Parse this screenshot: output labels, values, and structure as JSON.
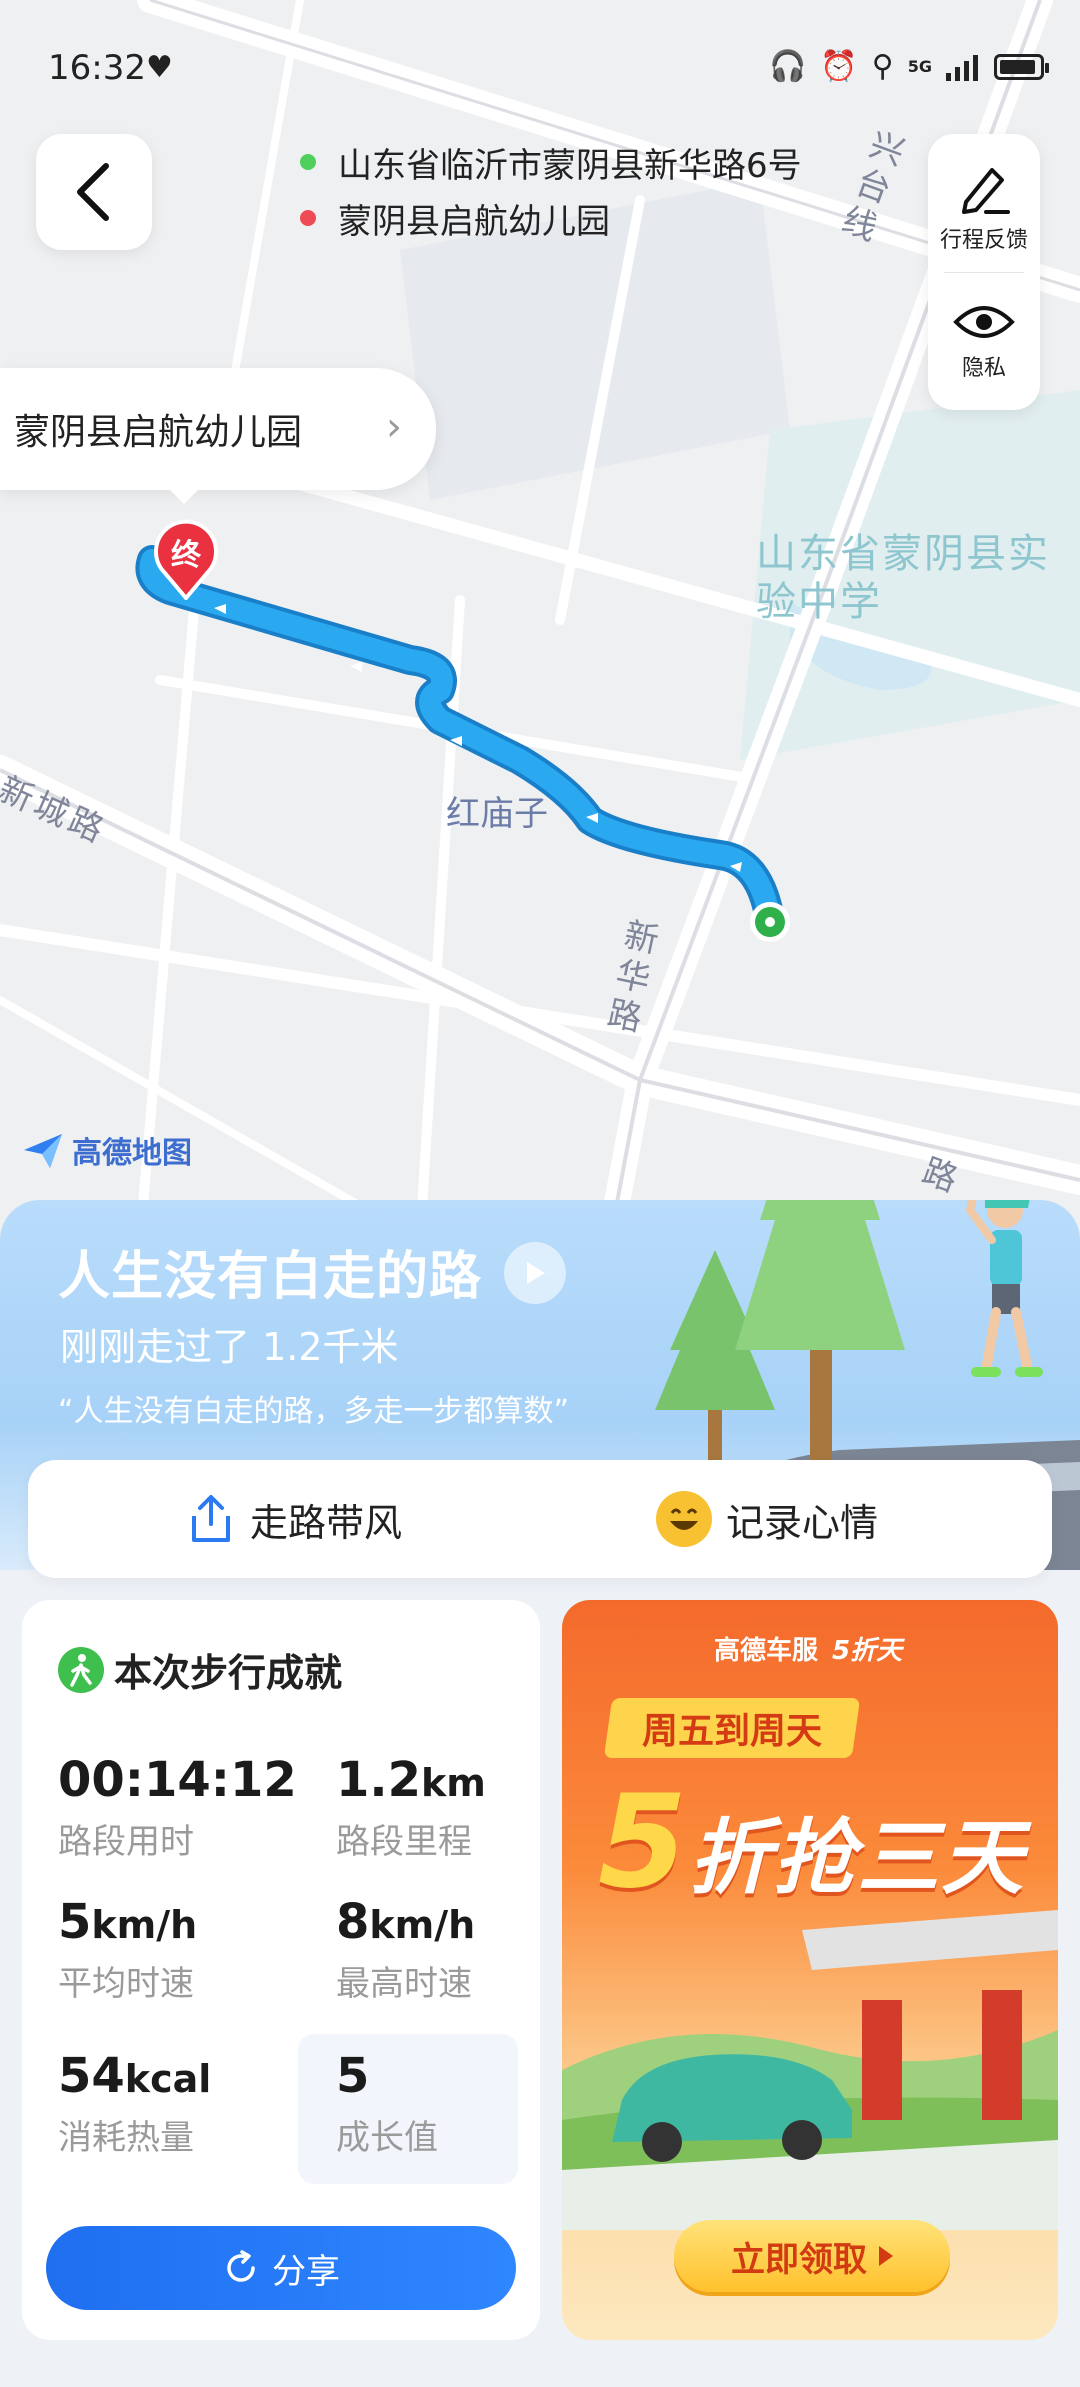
{
  "status_bar": {
    "time": "16:32",
    "signal": "5G"
  },
  "route": {
    "start": "山东省临沂市蒙阴县新华路6号",
    "end": "蒙阴县启航幼儿园"
  },
  "side_panel": {
    "feedback_label": "行程反馈",
    "privacy_label": "隐私"
  },
  "map": {
    "destination_callout": "蒙阴县启航幼儿园",
    "end_marker": "终",
    "labels": {
      "xincheng_road": "新城路",
      "xinhua_road": "新华路",
      "hongmiao": "红庙子",
      "school": "山东省蒙阴县实验中学",
      "xingtai_line": "兴台线",
      "road_suffix": "路"
    },
    "brand": "高德地图"
  },
  "banner": {
    "title": "人生没有白走的路",
    "subtitle": "刚刚走过了 1.2千米",
    "quote": "“人生没有白走的路，多走一步都算数”"
  },
  "actions": {
    "share_walk": "走路带风",
    "record_mood": "记录心情"
  },
  "stats": {
    "title": "本次步行成就",
    "duration": {
      "value": "00:14:12",
      "label": "路段用时"
    },
    "distance": {
      "value": "1.2",
      "unit": "km",
      "label": "路段里程"
    },
    "avg_speed": {
      "value": "5",
      "unit": "km/h",
      "label": "平均时速"
    },
    "max_speed": {
      "value": "8",
      "unit": "km/h",
      "label": "最高时速"
    },
    "calories": {
      "value": "54",
      "unit": "kcal",
      "label": "消耗热量"
    },
    "growth": {
      "value": "5",
      "label": "成长值"
    },
    "share_button": "分享"
  },
  "ad": {
    "brand": "高德车服",
    "brand2": "5折天",
    "tag": "周五到周天",
    "headline_num": "5",
    "headline_text": "折抢三天",
    "cta": "立即领取"
  },
  "colors": {
    "route_blue": "#2aa8f0",
    "start_green": "#2fb04a",
    "end_red": "#e93140",
    "primary_blue": "#1f6ff0"
  }
}
